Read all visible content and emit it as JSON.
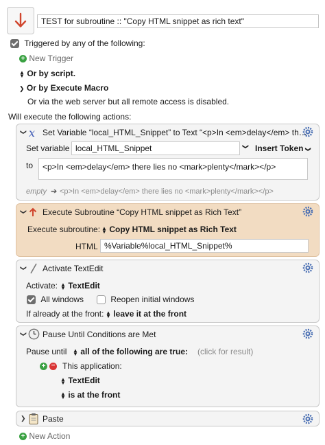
{
  "macro": {
    "title": "TEST for subroutine :: \"Copy HTML snippet as rich text\"",
    "icon": "down-arrow-icon",
    "accent": "#d0452d"
  },
  "triggers": {
    "triggered_label": "Triggered by any of the following:",
    "new_trigger": "New Trigger",
    "by_script": "Or by script.",
    "by_execute_macro": "Or by Execute Macro",
    "web_server": "Or via the web server but all remote access is disabled."
  },
  "actions_label": "Will execute the following actions:",
  "actions": {
    "set_variable": {
      "title": "Set Variable “local_HTML_Snippet” to Text “<p>In <em>delay</em> th…",
      "label": "Set variable",
      "variable": "local_HTML_Snippet",
      "insert_token": "Insert Token",
      "to_label": "to",
      "value": "<p>In <em>delay</em> there lies no <mark>plenty</mark></p>",
      "empty_label": "empty",
      "preview": "<p>In <em>delay</em> there lies no <mark>plenty</mark></p>"
    },
    "execute_subroutine": {
      "title": "Execute Subroutine “Copy HTML snippet as Rich Text”",
      "label": "Execute subroutine:",
      "subroutine": "Copy HTML snippet as Rich Text",
      "param_label": "HTML",
      "param_value": "%Variable%local_HTML_Snippet%"
    },
    "activate": {
      "title": "Activate TextEdit",
      "label": "Activate:",
      "app": "TextEdit",
      "all_windows": "All windows",
      "reopen": "Reopen initial windows",
      "front_label": "If already at the front:",
      "front_value": "leave it at the front"
    },
    "pause": {
      "title": "Pause Until Conditions are Met",
      "label": "Pause until",
      "condition": "all of the following are true:",
      "hint": "(click for result)",
      "this_app": "This application:",
      "app": "TextEdit",
      "state": "is at the front"
    },
    "paste": {
      "title": "Paste"
    }
  },
  "new_action": "New Action"
}
